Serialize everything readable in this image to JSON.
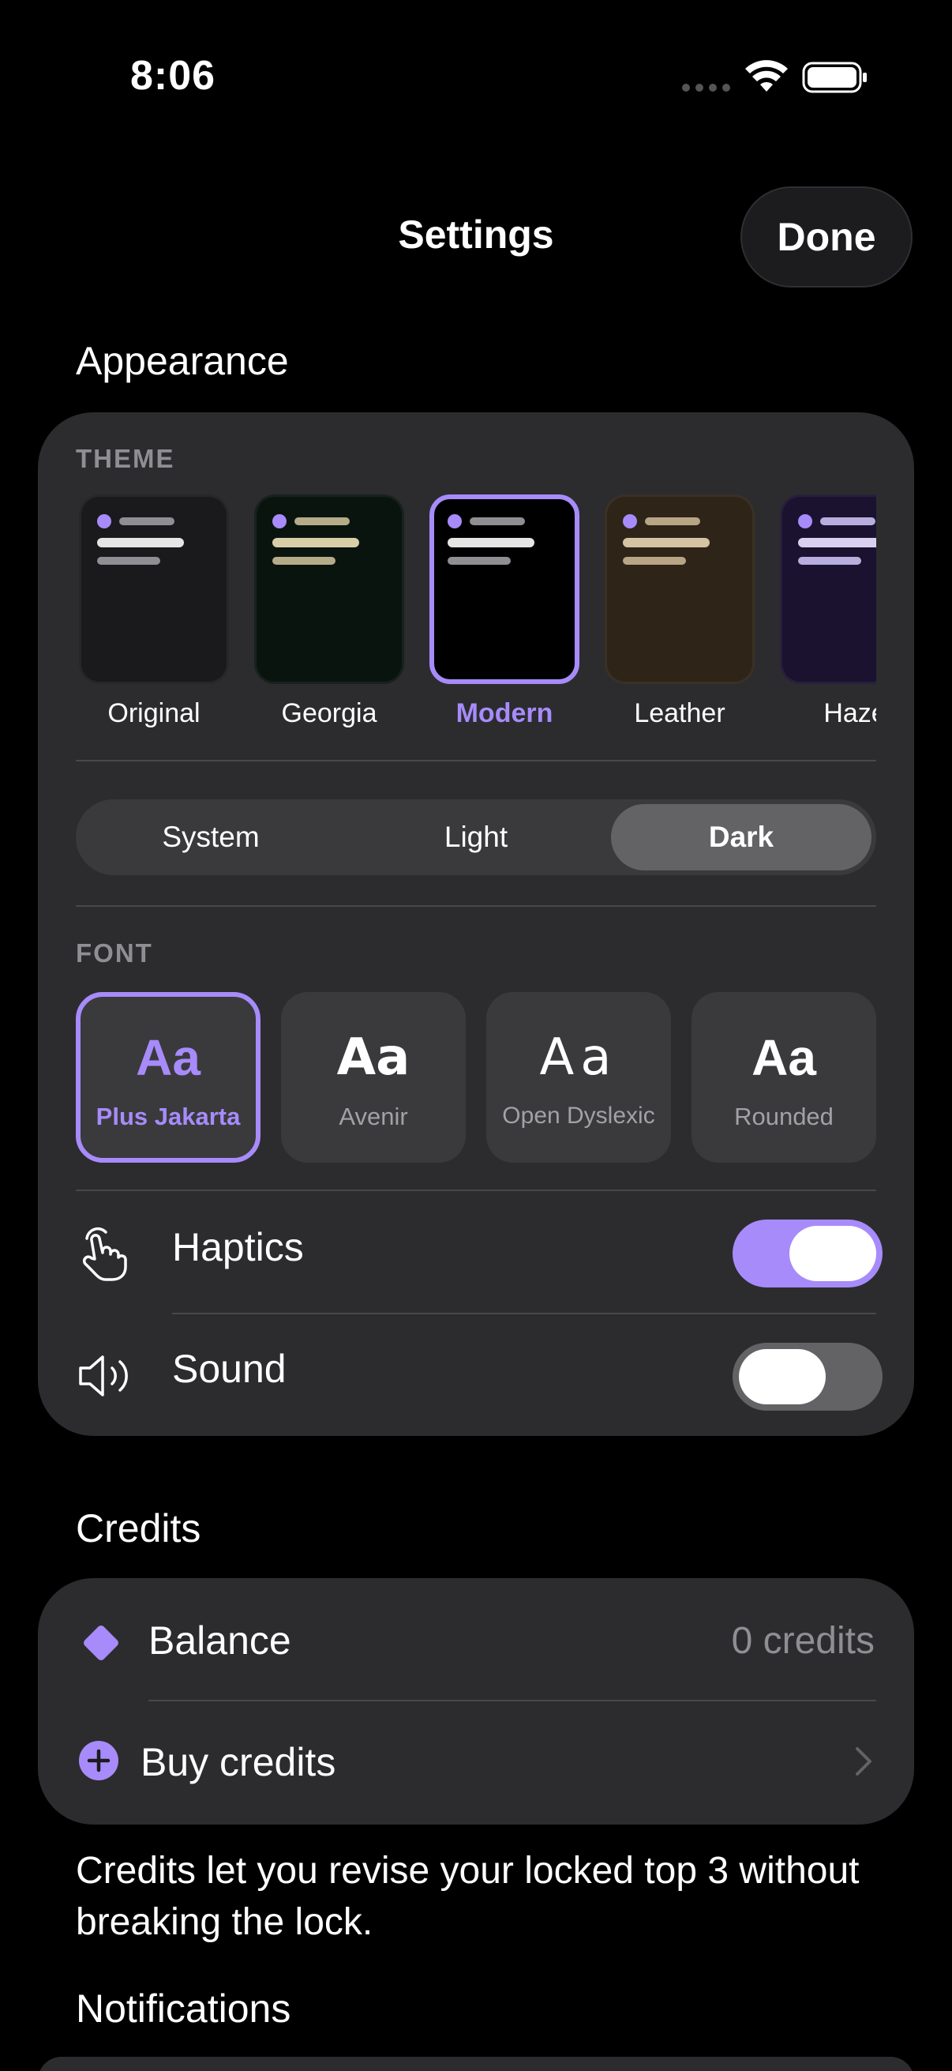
{
  "status_bar": {
    "time": "8:06",
    "icons": [
      "signal-dots-icon",
      "wifi-icon",
      "battery-icon"
    ]
  },
  "nav": {
    "title": "Settings",
    "done_label": "Done"
  },
  "appearance": {
    "section_title": "Appearance",
    "theme_label": "THEME",
    "themes": [
      {
        "name": "Original",
        "selected": false,
        "bg": "#1a1a1d",
        "line": "#e5e5e5"
      },
      {
        "name": "Georgia",
        "selected": false,
        "bg": "#0a140f",
        "line": "#d8cfa8"
      },
      {
        "name": "Modern",
        "selected": true,
        "bg": "#000000",
        "line": "#e5e5e5"
      },
      {
        "name": "Leather",
        "selected": false,
        "bg": "#2e2418",
        "line": "#d6c3a3"
      },
      {
        "name": "Haze",
        "selected": false,
        "bg": "#1b1230",
        "line": "#d9d0f0"
      }
    ],
    "mode_options": [
      "System",
      "Light",
      "Dark"
    ],
    "mode_selected": "Dark",
    "font_label": "FONT",
    "fonts": [
      {
        "sample": "Aa",
        "name": "Plus Jakarta",
        "selected": true
      },
      {
        "sample": "Aa",
        "name": "Avenir",
        "selected": false
      },
      {
        "sample": "Aa",
        "name": "Open Dyslexic",
        "selected": false
      },
      {
        "sample": "Aa",
        "name": "Rounded",
        "selected": false
      }
    ],
    "haptics_label": "Haptics",
    "haptics_on": true,
    "sound_label": "Sound",
    "sound_on": false
  },
  "credits": {
    "section_title": "Credits",
    "balance_label": "Balance",
    "balance_value": "0 credits",
    "buy_label": "Buy credits",
    "footnote": "Credits let you revise your locked top 3 without breaking the lock."
  },
  "notifications": {
    "section_title": "Notifications"
  },
  "colors": {
    "accent": "#a78bfa",
    "card": "#2c2c2e",
    "background": "#000000"
  }
}
